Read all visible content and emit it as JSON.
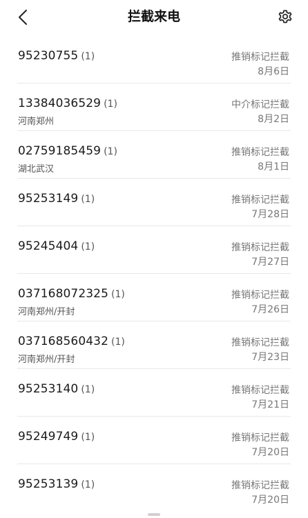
{
  "header": {
    "title": "拦截来电",
    "back_icon": "chevron-left-icon",
    "settings_icon": "gear-icon"
  },
  "calls": [
    {
      "number": "95230755",
      "count": "(1)",
      "location": "",
      "label": "推销标记拦截",
      "date": "8月6日"
    },
    {
      "number": "13384036529",
      "count": "(1)",
      "location": "河南郑州",
      "label": "中介标记拦截",
      "date": "8月2日"
    },
    {
      "number": "02759185459",
      "count": "(1)",
      "location": "湖北武汉",
      "label": "推销标记拦截",
      "date": "8月1日"
    },
    {
      "number": "95253149",
      "count": "(1)",
      "location": "",
      "label": "推销标记拦截",
      "date": "7月28日"
    },
    {
      "number": "95245404",
      "count": "(1)",
      "location": "",
      "label": "推销标记拦截",
      "date": "7月27日"
    },
    {
      "number": "037168072325",
      "count": "(1)",
      "location": "河南郑州/开封",
      "label": "推销标记拦截",
      "date": "7月26日"
    },
    {
      "number": "037168560432",
      "count": "(1)",
      "location": "河南郑州/开封",
      "label": "推销标记拦截",
      "date": "7月23日"
    },
    {
      "number": "95253140",
      "count": "(1)",
      "location": "",
      "label": "推销标记拦截",
      "date": "7月21日"
    },
    {
      "number": "95249749",
      "count": "(1)",
      "location": "",
      "label": "推销标记拦截",
      "date": "7月20日"
    },
    {
      "number": "95253139",
      "count": "(1)",
      "location": "",
      "label": "推销标记拦截",
      "date": "7月20日"
    }
  ]
}
